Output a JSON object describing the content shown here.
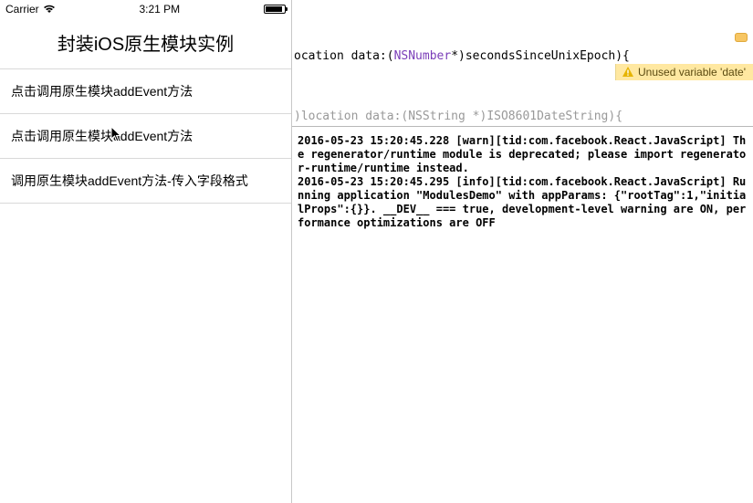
{
  "statusbar": {
    "carrier": "Carrier",
    "time": "3:21 PM"
  },
  "app": {
    "title": "封装iOS原生模块实例"
  },
  "list": {
    "items": [
      {
        "label": "点击调用原生模块addEvent方法"
      },
      {
        "label": "点击调用原生模块addEvent方法"
      },
      {
        "label": "调用原生模块addEvent方法-传入字段格式"
      }
    ]
  },
  "editor": {
    "prefix1": "ocation data:(",
    "type1": "NSNumber",
    "suffix1": "*)secondsSinceUnixEpoch){",
    "grayed": ")location data:(NSString *)ISO8601DateString){",
    "warning": "Unused variable 'date'"
  },
  "console": {
    "text": "2016-05-23 15:20:45.228 [warn][tid:com.facebook.React.JavaScript] The regenerator/runtime module is deprecated; please import regenerator-runtime/runtime instead.\n2016-05-23 15:20:45.295 [info][tid:com.facebook.React.JavaScript] Running application \"ModulesDemo\" with appParams: {\"rootTag\":1,\"initialProps\":{}}. __DEV__ === true, development-level warning are ON, performance optimizations are OFF"
  }
}
